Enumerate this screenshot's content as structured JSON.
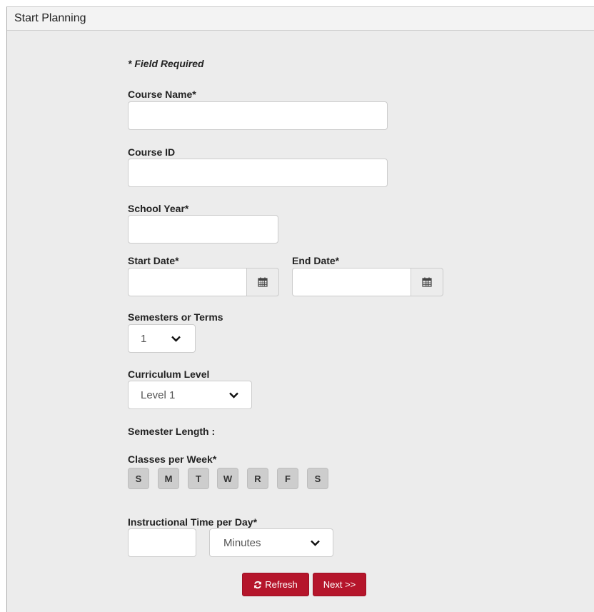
{
  "panel": {
    "title": "Start Planning"
  },
  "form": {
    "required_note": "* Field Required",
    "course_name": {
      "label": "Course Name*",
      "value": ""
    },
    "course_id": {
      "label": "Course ID",
      "value": ""
    },
    "school_year": {
      "label": "School Year*",
      "value": ""
    },
    "start_date": {
      "label": "Start Date*",
      "value": "",
      "icon": "calendar-icon"
    },
    "end_date": {
      "label": "End Date*",
      "value": "",
      "icon": "calendar-icon"
    },
    "semesters": {
      "label": "Semesters or Terms",
      "value": "1"
    },
    "curriculum": {
      "label": "Curriculum Level",
      "value": "Level 1"
    },
    "semester_length": {
      "label": "Semester Length :"
    },
    "classes_per_week": {
      "label": "Classes per Week*",
      "days": [
        "S",
        "M",
        "T",
        "W",
        "R",
        "F",
        "S"
      ]
    },
    "instructional_time": {
      "label": "Instructional Time per Day*",
      "value": "",
      "unit": "Minutes"
    }
  },
  "buttons": {
    "refresh": "Refresh",
    "next": "Next >>"
  },
  "colors": {
    "accent": "#b5152b",
    "panel_bg": "#ececec"
  }
}
